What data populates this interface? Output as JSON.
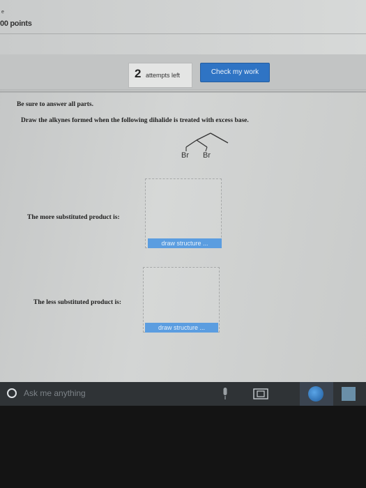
{
  "header": {
    "corner_mark": "e",
    "points": "00 points"
  },
  "actions": {
    "attempts_count": "2",
    "attempts_label": "attempts left",
    "check_button": "Check my work"
  },
  "question": {
    "instruction_1": "Be sure to answer all parts.",
    "instruction_2": "Draw the alkynes formed when the following dihalide is treated with excess base.",
    "molecule": {
      "halogen_left": "Br",
      "halogen_right": "Br"
    },
    "part_1": {
      "label": "The more substituted product is:",
      "button": "draw structure ..."
    },
    "part_2": {
      "label": "The less substituted product is:",
      "button": "draw structure ..."
    }
  },
  "taskbar": {
    "search_placeholder": "Ask me anything",
    "icons": [
      "cortana-icon",
      "microphone-icon",
      "task-view-icon",
      "browser-icon",
      "store-icon"
    ]
  }
}
